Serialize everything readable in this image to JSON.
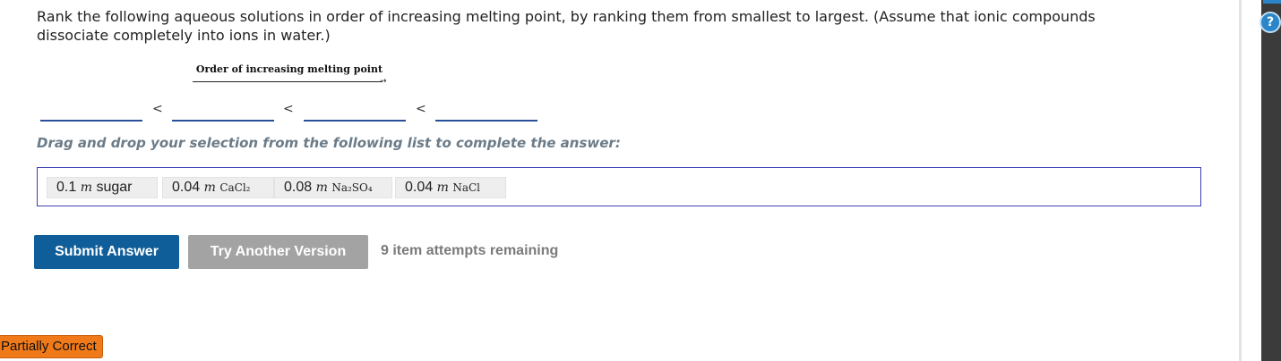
{
  "question": {
    "text": "Rank the following aqueous solutions in order of increasing melting point, by ranking them from smallest to largest. (Assume that ionic compounds dissociate completely into ions in water.)"
  },
  "order": {
    "label": "Order of increasing melting point",
    "arrow": "→",
    "separator": "<"
  },
  "instruction": "Drag and drop your selection from the following list to complete the answer:",
  "choices": [
    {
      "amount": "0.1",
      "unit": "m",
      "formula": "sugar"
    },
    {
      "amount": "0.04",
      "unit": "m",
      "formula": "CaCl₂"
    },
    {
      "amount": "0.08",
      "unit": "m",
      "formula": "Na₂SO₄"
    },
    {
      "amount": "0.04",
      "unit": "m",
      "formula": "NaCl"
    }
  ],
  "buttons": {
    "submit": "Submit Answer",
    "try_another": "Try Another Version"
  },
  "attempts_text": "9 item attempts remaining",
  "status_badge": "Partially Correct",
  "help_icon": "?",
  "colors": {
    "submit_bg": "#0f5e99",
    "try_bg": "#a3a3a3",
    "badge_bg": "#f07a1a",
    "drop_border": "#3a3fb0"
  }
}
